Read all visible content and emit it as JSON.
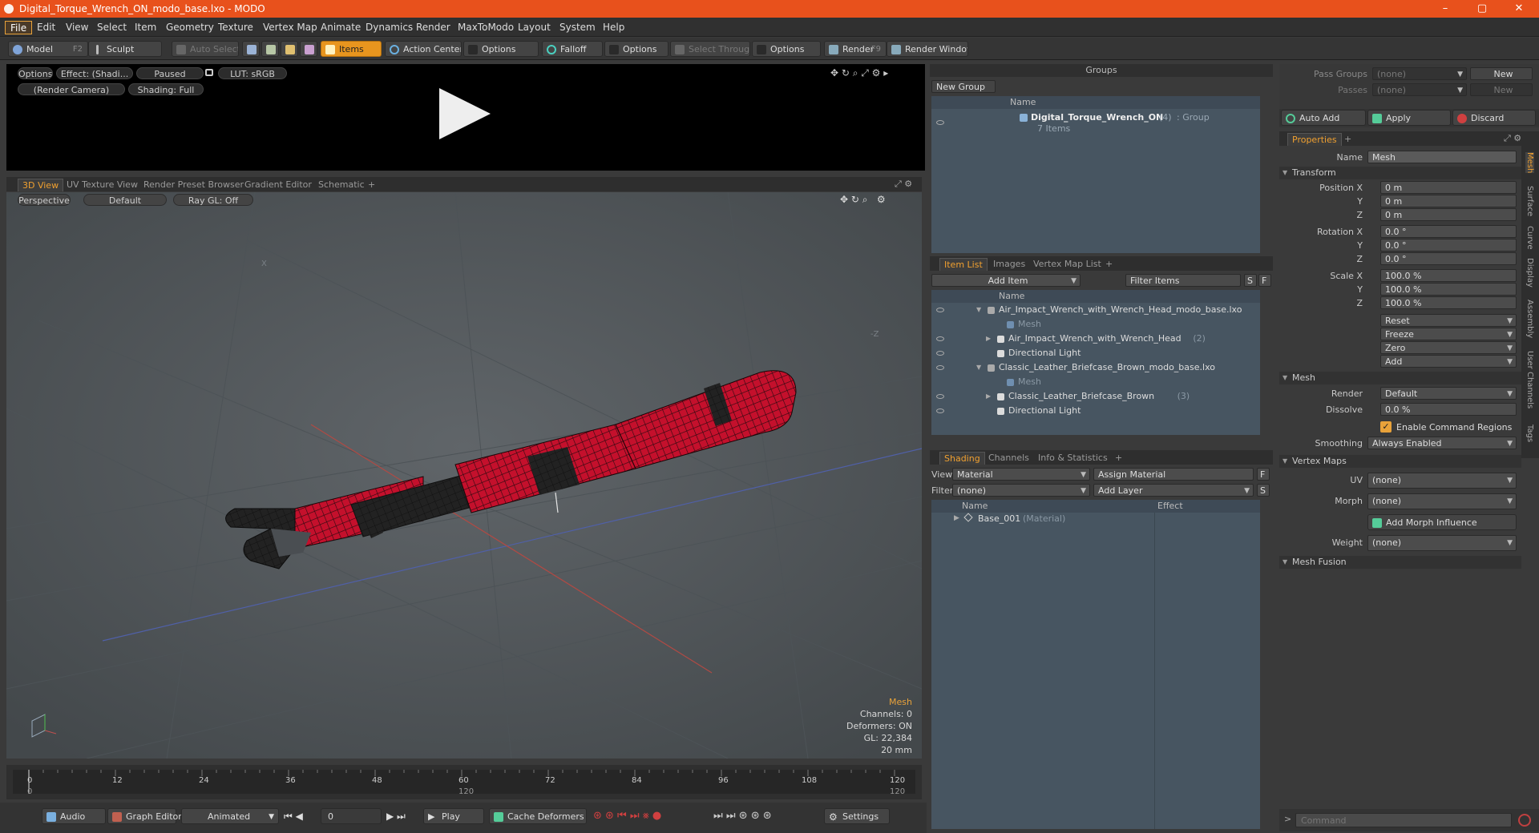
{
  "window": {
    "title": "Digital_Torque_Wrench_ON_modo_base.lxo - MODO",
    "minimize": "–",
    "maximize": "▢",
    "close": "✕"
  },
  "menu": [
    "File",
    "Edit",
    "View",
    "Select",
    "Item",
    "Geometry",
    "Texture",
    "Vertex Map",
    "Animate",
    "Dynamics",
    "Render",
    "MaxToModo",
    "Layout",
    "System",
    "Help"
  ],
  "toolbar": {
    "model": "Model",
    "model_key": "F2",
    "sculpt": "Sculpt",
    "auto_select": "Auto Select",
    "items": "Items",
    "action_center": "Action Center",
    "options1": "Options",
    "falloff": "Falloff",
    "options2": "Options",
    "select_through": "Select Through",
    "options3": "Options",
    "render": "Render",
    "render_key": "F9",
    "render_window": "Render Window"
  },
  "preview": {
    "options": "Options",
    "effect": "Effect: (Shadi...",
    "paused": "Paused",
    "lut": "LUT: sRGB",
    "camera": "(Render Camera)",
    "shading": "Shading: Full"
  },
  "view_tabs": [
    "3D View",
    "UV Texture View",
    "Render Preset Browser",
    "Gradient Editor",
    "Schematic",
    "+"
  ],
  "viewport": {
    "perspective": "Perspective",
    "default": "Default",
    "raygl": "Ray GL: Off",
    "axis_x": "X",
    "axis_z": "-Z",
    "info": {
      "title": "Mesh",
      "channels": "Channels: 0",
      "deformers": "Deformers: ON",
      "gl": "GL: 22,384",
      "scale": "20 mm"
    }
  },
  "timeline": {
    "ticks_top": [
      "0",
      "12",
      "24",
      "36",
      "48",
      "60",
      "72",
      "84",
      "96",
      "108",
      "120"
    ],
    "ticks_bottom": [
      "0",
      "120",
      "120"
    ]
  },
  "bottom": {
    "audio": "Audio",
    "graph_editor": "Graph Editor",
    "animated": "Animated",
    "frame": "0",
    "play": "Play",
    "cache_deformers": "Cache Deformers",
    "settings": "Settings"
  },
  "groups": {
    "title": "Groups",
    "new_group": "New Group",
    "col_name": "Name",
    "item_name": "Digital_Torque_Wrench_ON",
    "item_count": "(4)",
    "item_type": ": Group",
    "item_sub": "7 Items"
  },
  "passes": {
    "pass_groups_label": "Pass Groups",
    "pass_groups_val": "(none)",
    "new1": "New",
    "passes_label": "Passes",
    "passes_val": "(none)",
    "new2": "New",
    "auto_add": "Auto Add",
    "apply": "Apply",
    "discard": "Discard"
  },
  "itemlist": {
    "tabs": [
      "Item List",
      "Images",
      "Vertex Map List",
      "+"
    ],
    "add_item": "Add Item",
    "filter": "Filter Items",
    "s": "S",
    "f": "F",
    "col_name": "Name",
    "rows": [
      {
        "text": "Air_Impact_Wrench_with_Wrench_Head_modo_base.lxo",
        "indent": 0,
        "dim": false,
        "count": ""
      },
      {
        "text": "Mesh",
        "indent": 2,
        "dim": true,
        "count": ""
      },
      {
        "text": "Air_Impact_Wrench_with_Wrench_Head",
        "indent": 1,
        "dim": false,
        "count": "(2)"
      },
      {
        "text": "Directional Light",
        "indent": 1,
        "dim": false,
        "count": ""
      },
      {
        "text": "Classic_Leather_Briefcase_Brown_modo_base.lxo",
        "indent": 0,
        "dim": false,
        "count": ""
      },
      {
        "text": "Mesh",
        "indent": 2,
        "dim": true,
        "count": ""
      },
      {
        "text": "Classic_Leather_Briefcase_Brown",
        "indent": 1,
        "dim": false,
        "count": "(3)"
      },
      {
        "text": "Directional Light",
        "indent": 1,
        "dim": false,
        "count": ""
      }
    ]
  },
  "shading": {
    "tabs": [
      "Shading",
      "Channels",
      "Info & Statistics",
      "+"
    ],
    "view_label": "View",
    "view_val": "Material",
    "assign": "Assign Material",
    "f": "F",
    "filter_label": "Filter",
    "filter_val": "(none)",
    "add_layer": "Add Layer",
    "s": "S",
    "col_name": "Name",
    "col_effect": "Effect",
    "row_name": "Base_001",
    "row_type": "(Material)"
  },
  "properties": {
    "tab": "Properties",
    "plus": "+",
    "name_label": "Name",
    "name_val": "Mesh",
    "transform": "Transform",
    "pos_label": "Position X",
    "rot_label": "Rotation X",
    "scale_label": "Scale X",
    "y": "Y",
    "z": "Z",
    "pos": [
      "0 m",
      "0 m",
      "0 m"
    ],
    "rot": [
      "0.0 °",
      "0.0 °",
      "0.0 °"
    ],
    "scale": [
      "100.0 %",
      "100.0 %",
      "100.0 %"
    ],
    "reset": "Reset",
    "freeze": "Freeze",
    "zero": "Zero",
    "add": "Add",
    "mesh": "Mesh",
    "render_label": "Render",
    "render_val": "Default",
    "dissolve_label": "Dissolve",
    "dissolve_val": "0.0 %",
    "enable_cmd": "Enable Command Regions",
    "smoothing_label": "Smoothing",
    "smoothing_val": "Always Enabled",
    "vertex_maps": "Vertex Maps",
    "uv_label": "UV",
    "uv_val": "(none)",
    "morph_label": "Morph",
    "morph_val": "(none)",
    "add_morph": "Add Morph Influence",
    "weight_label": "Weight",
    "weight_val": "(none)",
    "mesh_fusion": "Mesh Fusion",
    "side_tabs": [
      "Mesh",
      "Surface",
      "Curve",
      "Display",
      "Assembly",
      "User Channels",
      "Tags"
    ]
  },
  "command": {
    "placeholder": "Command",
    "prompt": ">"
  }
}
